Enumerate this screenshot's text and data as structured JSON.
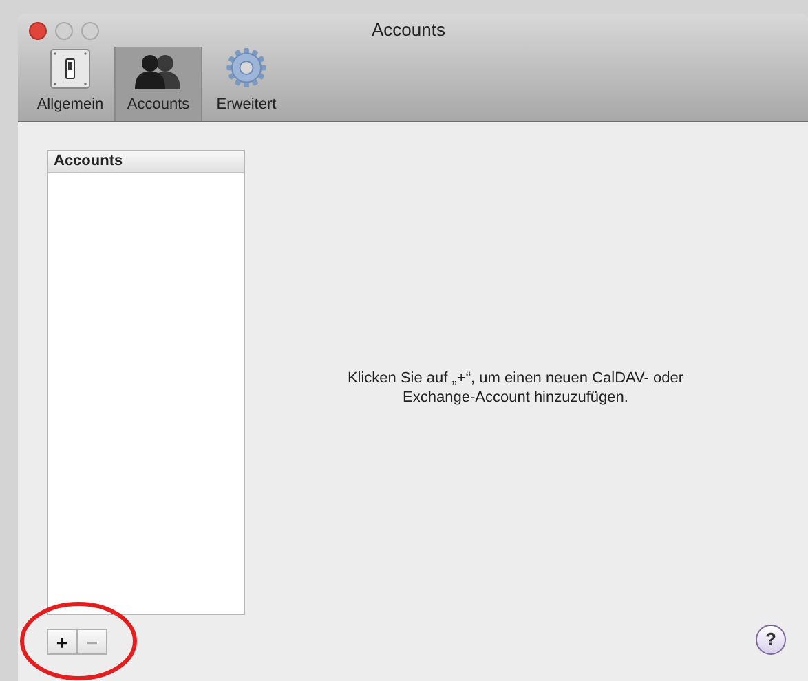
{
  "window": {
    "title": "Accounts"
  },
  "toolbar": {
    "items": [
      {
        "label": "Allgemein",
        "kind": "switch",
        "selected": false
      },
      {
        "label": "Accounts",
        "kind": "people",
        "selected": true
      },
      {
        "label": "Erweitert",
        "kind": "gear",
        "selected": false
      }
    ]
  },
  "accounts_list": {
    "header": "Accounts"
  },
  "list_buttons": [
    {
      "label": "+",
      "disabled": false
    },
    {
      "label": "−",
      "disabled": true
    }
  ],
  "message": "Klicken Sie auf „+“, um einen neuen CalDAV- oder Exchange-Account hinzuzufügen.",
  "help_button": {
    "label": "?"
  }
}
